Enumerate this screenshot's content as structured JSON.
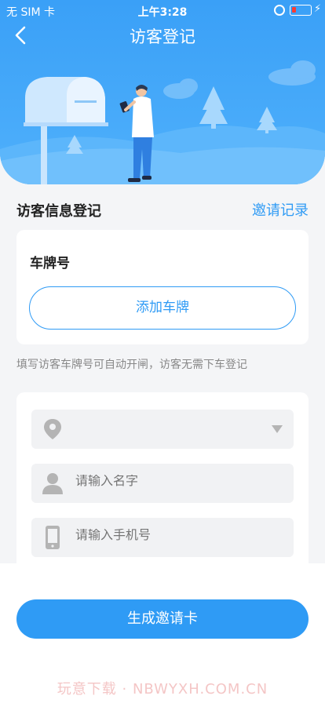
{
  "status_bar": {
    "carrier": "无 SIM 卡",
    "time": "上午3:28"
  },
  "nav": {
    "title": "访客登记",
    "back_icon": "chevron-left-icon"
  },
  "section": {
    "title": "访客信息登记",
    "link": "邀请记录"
  },
  "plate": {
    "label": "车牌号",
    "add_button": "添加车牌"
  },
  "hint": "填写访客车牌号可自动开闸，访客无需下车登记",
  "form": {
    "location": {
      "icon": "location-pin-icon",
      "value": ""
    },
    "name": {
      "icon": "person-icon",
      "placeholder": "请输入名字"
    },
    "phone": {
      "icon": "phone-icon",
      "placeholder": "请输入手机号"
    }
  },
  "generate_button": "生成邀请卡",
  "watermark": "玩意下载 · NBWYXH.COM.CN",
  "colors": {
    "primary": "#2f9bf5",
    "header": "#3aa0f7"
  }
}
